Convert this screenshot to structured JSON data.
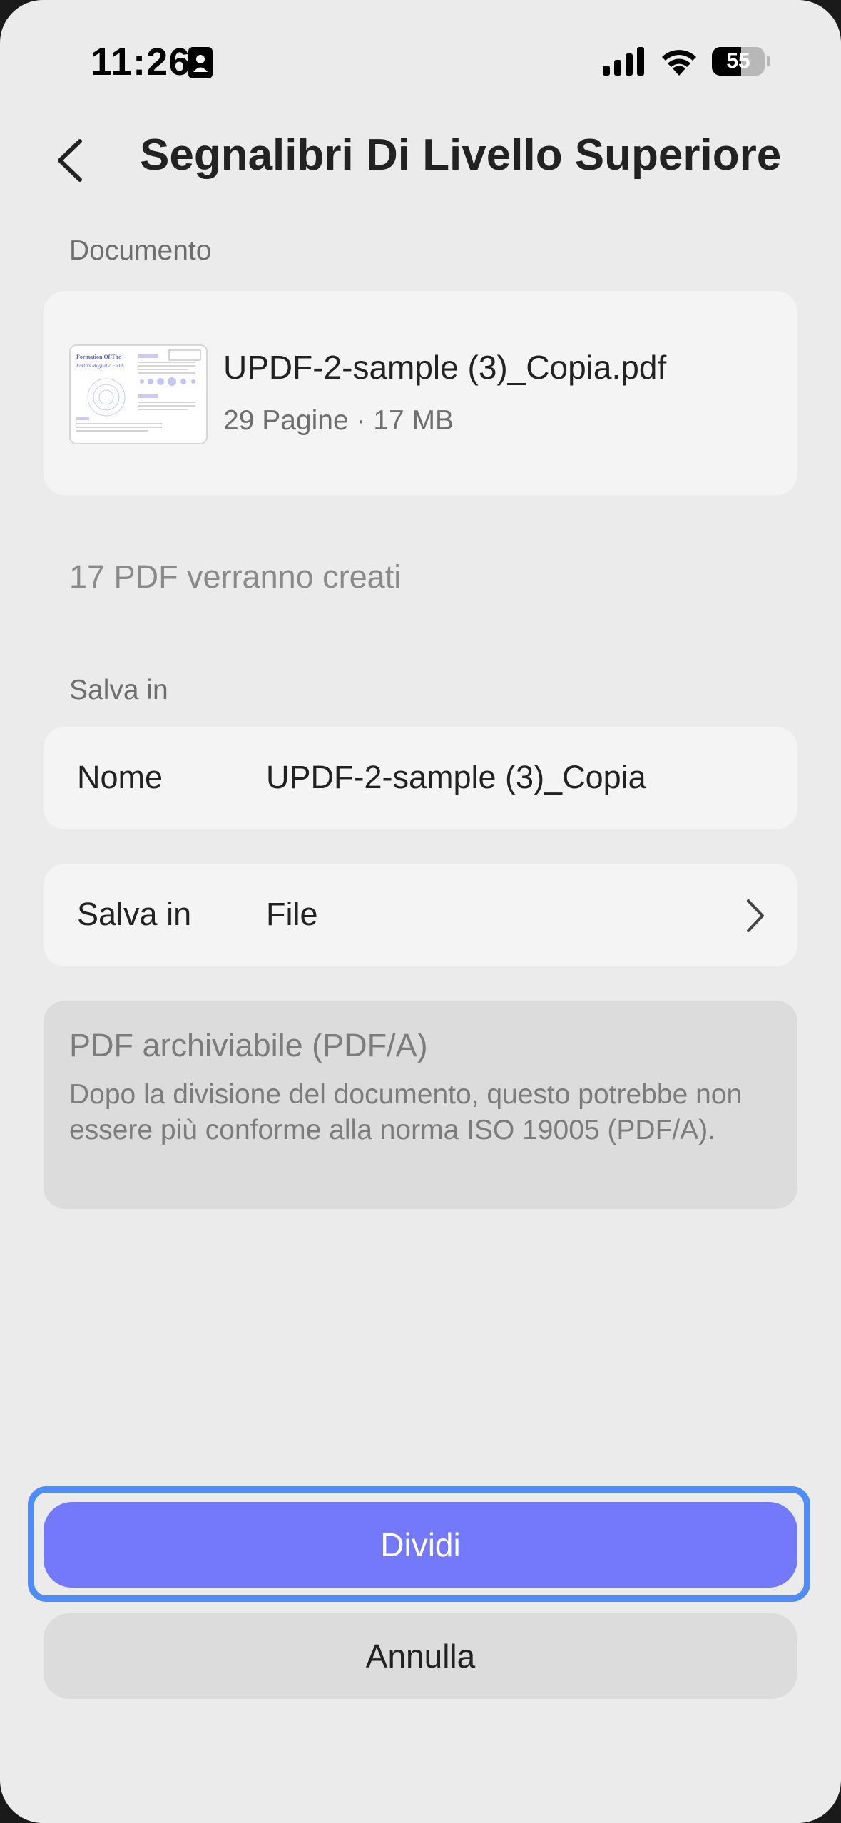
{
  "status_bar": {
    "time": "11:26",
    "battery_level": "55",
    "battery_fraction": 0.55,
    "icons": [
      "id-card-icon",
      "cellular-signal-icon",
      "wifi-icon",
      "battery-icon"
    ]
  },
  "header": {
    "back_icon": "chevron-left-icon",
    "title": "Segnalibri Di Livello Superiore"
  },
  "document_section": {
    "label": "Documento",
    "file": {
      "name": "UPDF-2-sample (3)_Copia.pdf",
      "meta": "29 Pagine · 17 MB",
      "thumbnail_heading_line1": "Formation Of The",
      "thumbnail_heading_line2": "Earth's Magnetic Field"
    }
  },
  "info": {
    "count_text": "17 PDF verranno creati"
  },
  "save_section": {
    "label": "Salva in",
    "name_row": {
      "label": "Nome",
      "value": "UPDF-2-sample (3)_Copia"
    },
    "location_row": {
      "label": "Salva in",
      "value": "File",
      "icon": "chevron-right-icon"
    }
  },
  "pdfa_notice": {
    "title": "PDF archiviabile (PDF/A)",
    "description": "Dopo la divisione del documento, questo potrebbe non essere più conforme alla norma ISO 19005 (PDF/A)."
  },
  "actions": {
    "primary_label": "Dividi",
    "secondary_label": "Annulla"
  },
  "colors": {
    "background": "#ebebeb",
    "card": "#f4f4f4",
    "primary_button": "#7478fb",
    "focus_outline": "#4f8cf7",
    "secondary_button": "#dcdcdc"
  }
}
